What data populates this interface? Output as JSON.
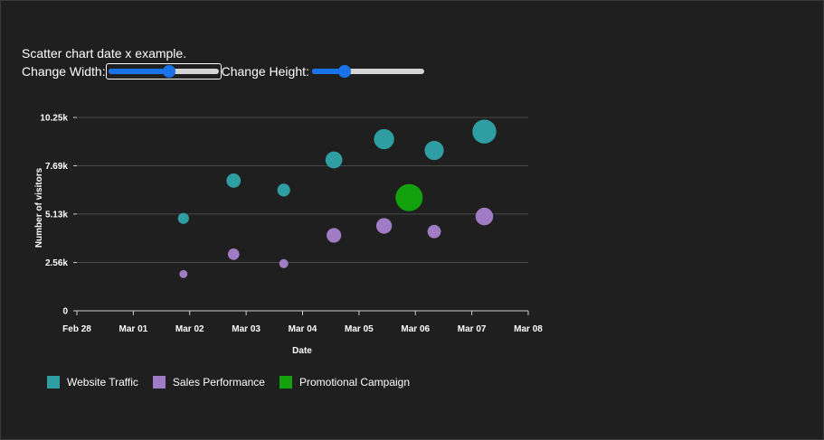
{
  "page": {
    "title": "Scatter chart date x example."
  },
  "controls": {
    "width_label": "Change Width:",
    "width_value": 0.55,
    "height_label": "Change Height:",
    "height_value": 0.29
  },
  "colors": {
    "background": "#1f1f1f",
    "grid": "#4a4a4a",
    "text": "#ffffff",
    "accent": "#1a73e8"
  },
  "chart_data": {
    "type": "scatter",
    "title": "",
    "xlabel": "Date",
    "ylabel": "Number of visitors",
    "xlim": [
      "2024-02-28",
      "2024-03-08"
    ],
    "ylim": [
      0,
      10250
    ],
    "x_ticks": [
      "Feb 28",
      "Mar 01",
      "Mar 02",
      "Mar 03",
      "Mar 04",
      "Mar 05",
      "Mar 06",
      "Mar 07",
      "Mar 08"
    ],
    "y_ticks": [
      {
        "value": 0,
        "label": "0"
      },
      {
        "value": 2560,
        "label": "2.56k"
      },
      {
        "value": 5130,
        "label": "5.13k"
      },
      {
        "value": 7690,
        "label": "7.69k"
      },
      {
        "value": 10250,
        "label": "10.25k"
      }
    ],
    "grid": true,
    "legend_position": "bottom-left",
    "series": [
      {
        "name": "Website Traffic",
        "color": "#2e9ea3",
        "points": [
          {
            "x": "2024-03-01T03:00",
            "y": 4900,
            "size": 150
          },
          {
            "x": "2024-03-02T03:00",
            "y": 6900,
            "size": 250
          },
          {
            "x": "2024-03-03T03:00",
            "y": 6400,
            "size": 200
          },
          {
            "x": "2024-03-04T03:00",
            "y": 8000,
            "size": 350
          },
          {
            "x": "2024-03-05T03:00",
            "y": 9100,
            "size": 500
          },
          {
            "x": "2024-03-06T03:00",
            "y": 8500,
            "size": 450
          },
          {
            "x": "2024-03-07T03:00",
            "y": 9500,
            "size": 700
          }
        ]
      },
      {
        "name": "Sales Performance",
        "color": "#a07cc5",
        "points": [
          {
            "x": "2024-03-01T03:00",
            "y": 1950,
            "size": 80
          },
          {
            "x": "2024-03-02T03:00",
            "y": 3000,
            "size": 160
          },
          {
            "x": "2024-03-03T03:00",
            "y": 2500,
            "size": 100
          },
          {
            "x": "2024-03-04T03:00",
            "y": 4000,
            "size": 260
          },
          {
            "x": "2024-03-05T03:00",
            "y": 4500,
            "size": 300
          },
          {
            "x": "2024-03-06T03:00",
            "y": 4200,
            "size": 220
          },
          {
            "x": "2024-03-07T03:00",
            "y": 5000,
            "size": 380
          }
        ]
      },
      {
        "name": "Promotional Campaign",
        "color": "#13a10e",
        "points": [
          {
            "x": "2024-03-05T15:00",
            "y": 6000,
            "size": 900
          }
        ]
      }
    ]
  }
}
